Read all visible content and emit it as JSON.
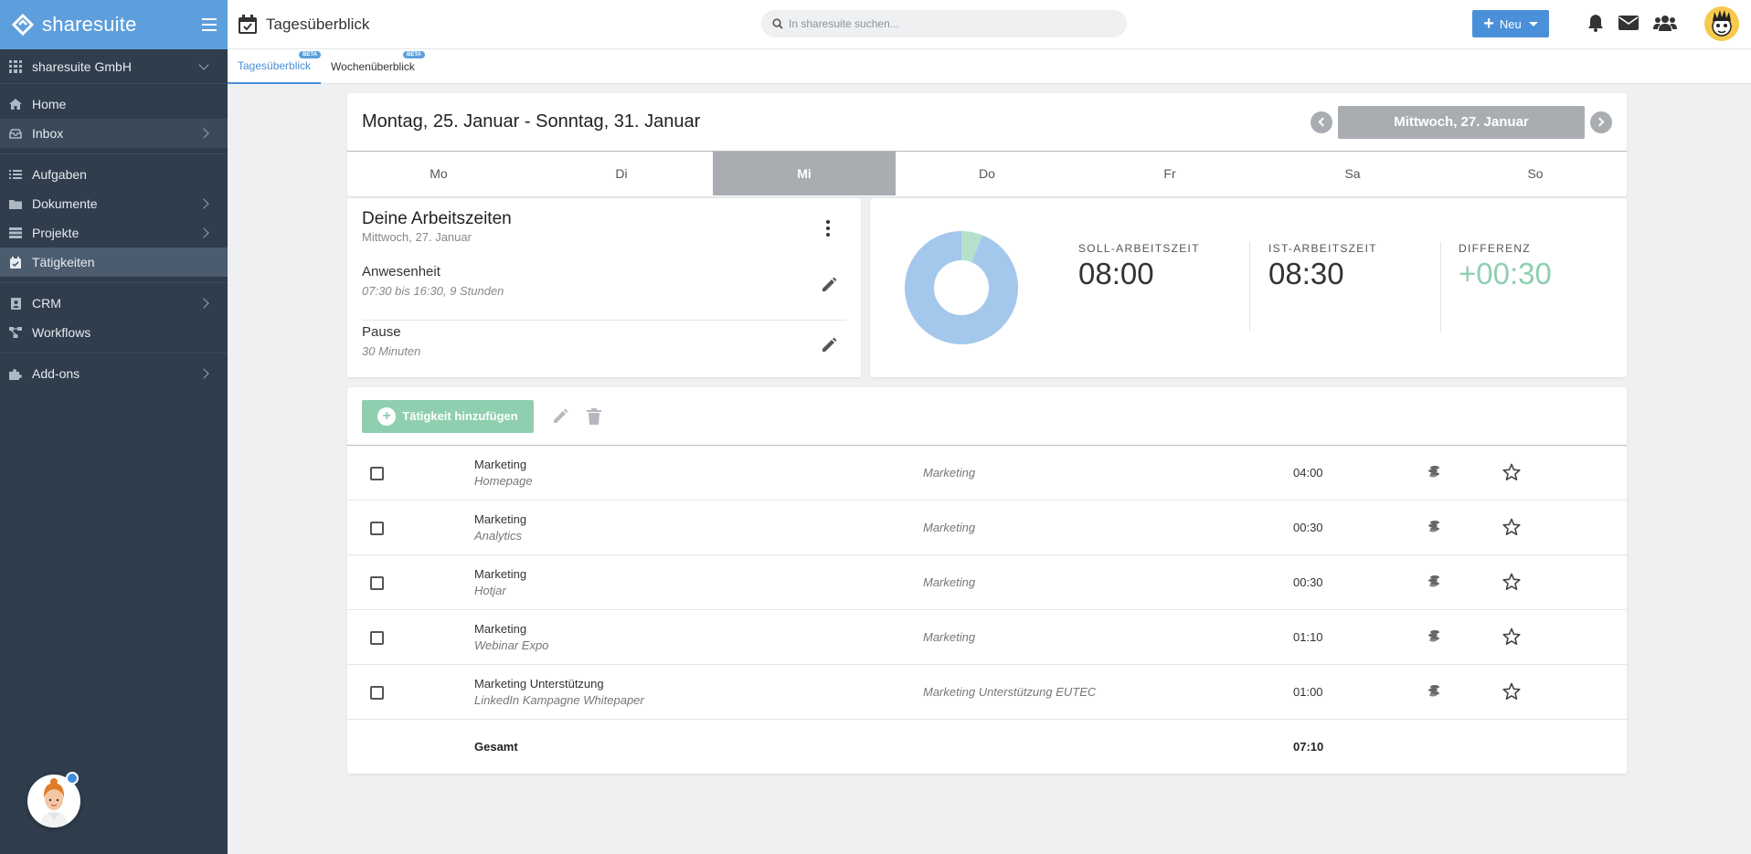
{
  "brand": {
    "name": "sharesuite"
  },
  "company": {
    "name": "sharesuite GmbH"
  },
  "nav": {
    "home": "Home",
    "inbox": "Inbox",
    "aufgaben": "Aufgaben",
    "dokumente": "Dokumente",
    "projekte": "Projekte",
    "taetigkeiten": "Tätigkeiten",
    "crm": "CRM",
    "workflows": "Workflows",
    "addons": "Add-ons"
  },
  "header": {
    "title": "Tagesüberblick",
    "search_placeholder": "In sharesuite suchen...",
    "new_label": "Neu"
  },
  "tabs": [
    {
      "label": "Tagesüberblick",
      "badge": "BETA"
    },
    {
      "label": "Wochenüberblick",
      "badge": "BETA"
    }
  ],
  "week": {
    "range": "Montag, 25. Januar - Sonntag, 31. Januar",
    "selected_date": "Mittwoch, 27. Januar",
    "days": [
      "Mo",
      "Di",
      "Mi",
      "Do",
      "Fr",
      "Sa",
      "So"
    ]
  },
  "work": {
    "title": "Deine Arbeitszeiten",
    "date": "Mittwoch, 27. Januar",
    "rows": [
      {
        "label": "Anwesenheit",
        "sub": "07:30 bis 16:30, 9 Stunden"
      },
      {
        "label": "Pause",
        "sub": "30 Minuten"
      }
    ]
  },
  "stats": {
    "soll_label": "SOLL-ARBEITSZEIT",
    "soll_value": "08:00",
    "ist_label": "IST-ARBEITSZEIT",
    "ist_value": "08:30",
    "diff_label": "DIFFERENZ",
    "diff_value": "+00:30",
    "donut_fraction_small": 0.06,
    "colors": {
      "donut_main": "#a3c8ec",
      "donut_small": "#b5e0cc",
      "diff": "#8ecfb1"
    }
  },
  "activities": {
    "add_label": "Tätigkeit hinzufügen",
    "rows": [
      {
        "title": "Marketing",
        "sub": "Homepage",
        "category": "Marketing",
        "time": "04:00"
      },
      {
        "title": "Marketing",
        "sub": "Analytics",
        "category": "Marketing",
        "time": "00:30"
      },
      {
        "title": "Marketing",
        "sub": "Hotjar",
        "category": "Marketing",
        "time": "00:30"
      },
      {
        "title": "Marketing",
        "sub": "Webinar Expo",
        "category": "Marketing",
        "time": "01:10"
      },
      {
        "title": "Marketing Unterstützung",
        "sub": "LinkedIn Kampagne Whitepaper",
        "category": "Marketing Unterstützung EUTEC",
        "time": "01:00"
      }
    ],
    "total_label": "Gesamt",
    "total_time": "07:10"
  },
  "colors": {
    "brand": "#5d9fdc",
    "sidebar": "#2f3d4c",
    "accent": "#4a90d9",
    "add_button": "#8fcfb0"
  }
}
